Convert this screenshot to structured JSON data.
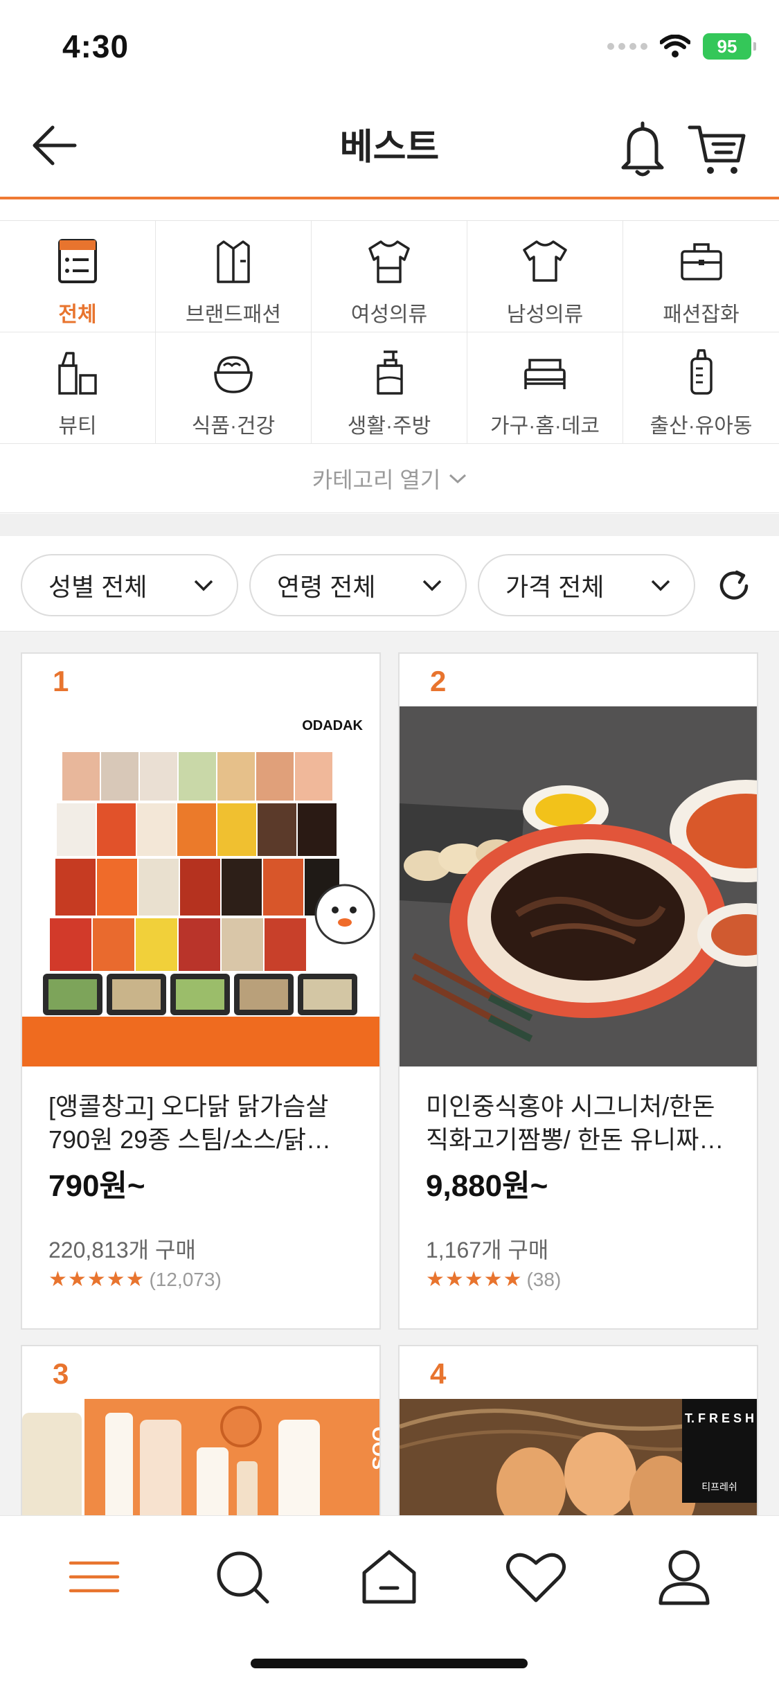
{
  "status_bar": {
    "time": "4:30",
    "battery": "95"
  },
  "header": {
    "title": "베스트"
  },
  "categories": [
    {
      "label": "전체",
      "active": true,
      "icon": "list-icon"
    },
    {
      "label": "브랜드패션",
      "active": false,
      "icon": "shirt-icon"
    },
    {
      "label": "여성의류",
      "active": false,
      "icon": "blouse-icon"
    },
    {
      "label": "남성의류",
      "active": false,
      "icon": "tshirt-icon"
    },
    {
      "label": "패션잡화",
      "active": false,
      "icon": "bag-icon"
    },
    {
      "label": "뷰티",
      "active": false,
      "icon": "lipstick-icon"
    },
    {
      "label": "식품·건강",
      "active": false,
      "icon": "food-bowl-icon"
    },
    {
      "label": "생활·주방",
      "active": false,
      "icon": "pump-bottle-icon"
    },
    {
      "label": "가구·홈·데코",
      "active": false,
      "icon": "bed-icon"
    },
    {
      "label": "출산·유아동",
      "active": false,
      "icon": "baby-bottle-icon"
    }
  ],
  "category_open_label": "카테고리 열기",
  "filters": [
    {
      "label": "성별 전체"
    },
    {
      "label": "연령 전체"
    },
    {
      "label": "가격 전체"
    }
  ],
  "products": [
    {
      "rank": "1",
      "brand_mark": "ODADAK",
      "title_line1": "[앵콜창고] 오다닭 닭가슴살",
      "title_line2": "790원 29종 스팀/소스/닭…",
      "price": "790원~",
      "buys": "220,813개 구매",
      "stars": "★★★★★",
      "rating_value": 4.5,
      "review_count": "(12,073)"
    },
    {
      "rank": "2",
      "title_line1": "미인중식홍야 시그니처/한돈",
      "title_line2": "직화고기짬뽕/ 한돈 유니짜…",
      "price": "9,880원~",
      "buys": "1,167개 구매",
      "stars": "★★★★★",
      "rating_value": 5,
      "review_count": "(38)"
    },
    {
      "rank": "3",
      "brand_mark": "OOS"
    },
    {
      "rank": "4",
      "brand_mark": "T. F R E S H",
      "brand_sub": "티프레쉬"
    }
  ],
  "colors": {
    "accent": "#e8742e",
    "header_border": "#ef7a33",
    "battery": "#34c759"
  }
}
